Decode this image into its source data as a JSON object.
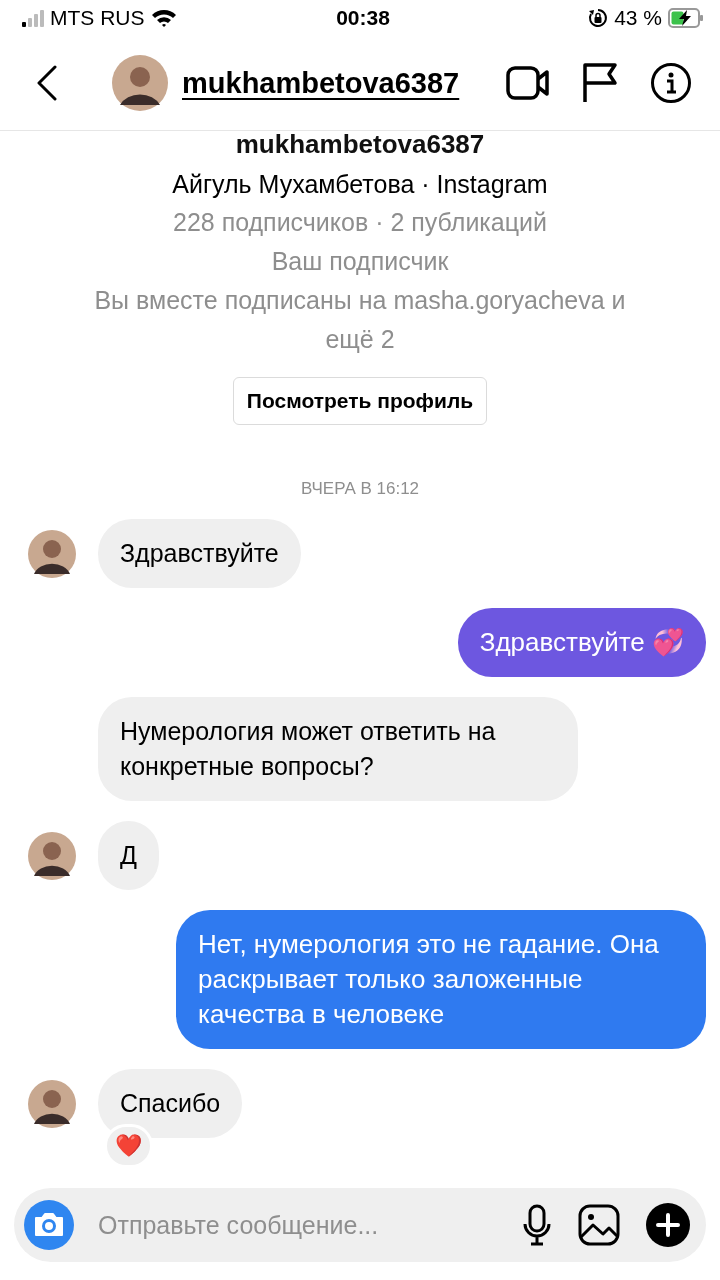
{
  "status_bar": {
    "carrier": "MTS RUS",
    "time": "00:38",
    "battery": "43 %"
  },
  "header": {
    "username": "mukhambetova6387"
  },
  "profile": {
    "username": "mukhambetova6387",
    "full_name": "Айгуль Мухамбетова · Instagram",
    "stats": "228 подписчиков · 2 публикаций",
    "relation": "Ваш подписчик",
    "mutual": "Вы вместе подписаны на masha.goryacheva и ещё 2",
    "button": "Посмотреть профиль"
  },
  "timestamp": "ВЧЕРА В 16:12",
  "messages": [
    {
      "kind": "incoming",
      "text": "Здравствуйте",
      "avatar": true
    },
    {
      "kind": "outgoing",
      "text": "Здравствуйте 💞",
      "color": "#6d57e0"
    },
    {
      "kind": "incoming",
      "text": "Нумерология может ответить на конкретные вопросы?",
      "avatar": false
    },
    {
      "kind": "incoming",
      "text": "Д",
      "avatar": true
    },
    {
      "kind": "outgoing",
      "text": "Нет, нумерология это не гадание. Она раскрывает только заложенные качества в человеке",
      "color": "#2f7af0"
    },
    {
      "kind": "incoming",
      "text": "Спасибо",
      "avatar": true,
      "reaction": "❤️"
    }
  ],
  "composer": {
    "placeholder": "Отправьте сообщение..."
  }
}
